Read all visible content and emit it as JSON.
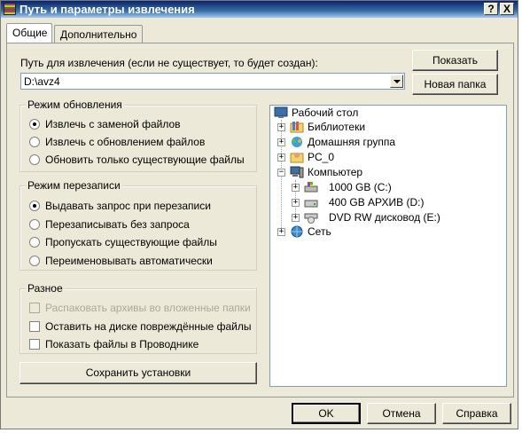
{
  "window": {
    "title": "Путь и параметры извлечения",
    "help_label": "?",
    "close_label": "X"
  },
  "tabs": [
    {
      "label": "Общие",
      "active": true
    },
    {
      "label": "Дополнительно",
      "active": false
    }
  ],
  "path": {
    "label": "Путь для извлечения (если не существует, то будет создан):",
    "value": "D:\\avz4"
  },
  "side_buttons": {
    "show": "Показать",
    "new_folder": "Новая папка"
  },
  "update_mode": {
    "title": "Режим обновления",
    "options": [
      {
        "label": "Извлечь с заменой файлов",
        "selected": true
      },
      {
        "label": "Извлечь с обновлением файлов",
        "selected": false
      },
      {
        "label": "Обновить только существующие файлы",
        "selected": false
      }
    ]
  },
  "overwrite_mode": {
    "title": "Режим перезаписи",
    "options": [
      {
        "label": "Выдавать запрос при перезаписи",
        "selected": true
      },
      {
        "label": "Перезаписывать без запроса",
        "selected": false
      },
      {
        "label": "Пропускать существующие файлы",
        "selected": false
      },
      {
        "label": "Переименовывать автоматически",
        "selected": false
      }
    ]
  },
  "misc": {
    "title": "Разное",
    "options": [
      {
        "label": "Распаковать архивы во вложенные папки",
        "checked": false,
        "disabled": true
      },
      {
        "label": "Оставить на диске повреждённые файлы",
        "checked": false,
        "disabled": false
      },
      {
        "label": "Показать файлы в Проводнике",
        "checked": false,
        "disabled": false
      }
    ]
  },
  "save_settings": "Сохранить установки",
  "tree": {
    "root": "Рабочий стол",
    "items": [
      {
        "label": "Библиотеки",
        "icon": "library-icon"
      },
      {
        "label": "Домашняя группа",
        "icon": "homegroup-icon"
      },
      {
        "label": "PC_0",
        "icon": "user-folder-icon"
      },
      {
        "label": "Компьютер",
        "icon": "computer-icon"
      },
      {
        "label": "1000 GB (C:)",
        "icon": "system-drive-icon"
      },
      {
        "label": "400 GB АРХИВ (D:)",
        "icon": "drive-icon"
      },
      {
        "label": "DVD RW дисковод (E:)",
        "icon": "dvd-drive-icon"
      },
      {
        "label": "Сеть",
        "icon": "network-icon"
      }
    ]
  },
  "footer": {
    "ok": "OK",
    "cancel": "Отмена",
    "help": "Справка"
  }
}
